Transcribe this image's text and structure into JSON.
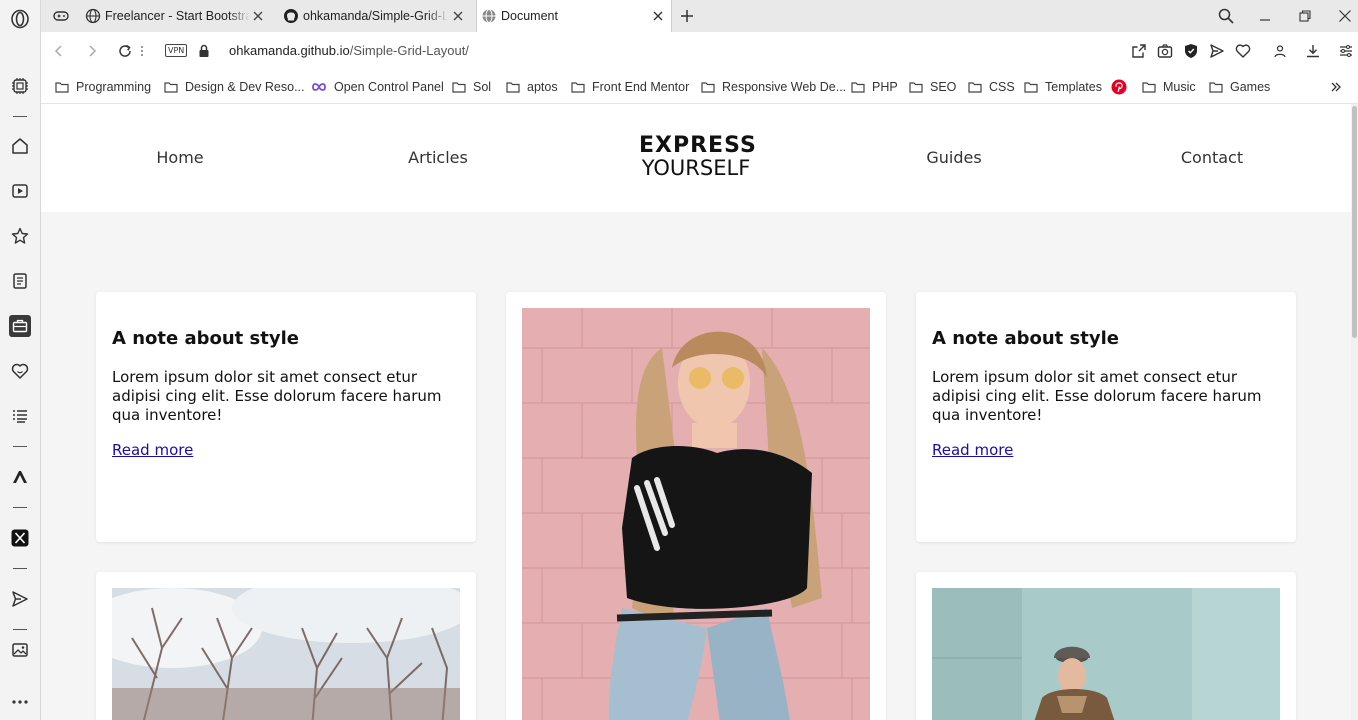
{
  "browser": {
    "tabs": [
      {
        "title": "Freelancer - Start Bootstrap",
        "favicon": "globe-icon"
      },
      {
        "title": "ohkamanda/Simple-Grid-Layout",
        "favicon": "github-icon"
      },
      {
        "title": "Document",
        "favicon": "globe-icon",
        "active": true
      }
    ],
    "url": {
      "host": "ohkamanda.github.io",
      "path": "/Simple-Grid-Layout/"
    },
    "vpn_label": "VPN",
    "bookmarks": [
      {
        "label": "Programming",
        "icon": "folder-icon"
      },
      {
        "label": "Design & Dev Reso...",
        "icon": "folder-icon"
      },
      {
        "label": "Open Control Panel",
        "icon": "infinity-icon"
      },
      {
        "label": "Sol",
        "icon": "folder-icon"
      },
      {
        "label": "aptos",
        "icon": "folder-icon"
      },
      {
        "label": "Front End Mentor",
        "icon": "folder-icon"
      },
      {
        "label": "Responsive Web De...",
        "icon": "folder-icon"
      },
      {
        "label": "PHP",
        "icon": "folder-icon"
      },
      {
        "label": "SEO",
        "icon": "folder-icon"
      },
      {
        "label": "CSS",
        "icon": "folder-icon"
      },
      {
        "label": "Templates",
        "icon": "folder-icon"
      },
      {
        "label": "",
        "icon": "pinterest-icon"
      },
      {
        "label": "Music",
        "icon": "folder-icon"
      },
      {
        "label": "Games",
        "icon": "folder-icon"
      }
    ]
  },
  "site": {
    "nav": {
      "home": "Home",
      "articles": "Articles",
      "guides": "Guides",
      "contact": "Contact"
    },
    "logo": {
      "line1": "EXPRESS",
      "line2": "YOURSELF"
    },
    "cards": [
      {
        "title": "A note about style",
        "body": "Lorem ipsum dolor sit amet consect etur adipisi cing elit. Esse dolorum facere harum qua inventore!",
        "link": "Read more"
      },
      {
        "title": "A note about style",
        "body": "Lorem ipsum dolor sit amet consect etur adipisi cing elit. Esse dolorum facere harum qua inventore!",
        "link": "Read more"
      }
    ]
  },
  "colors": {
    "page_bg": "#f5f5f5",
    "link": "#1a0dab",
    "pinterest": "#e60023",
    "infinity": "#7b4fd6"
  }
}
